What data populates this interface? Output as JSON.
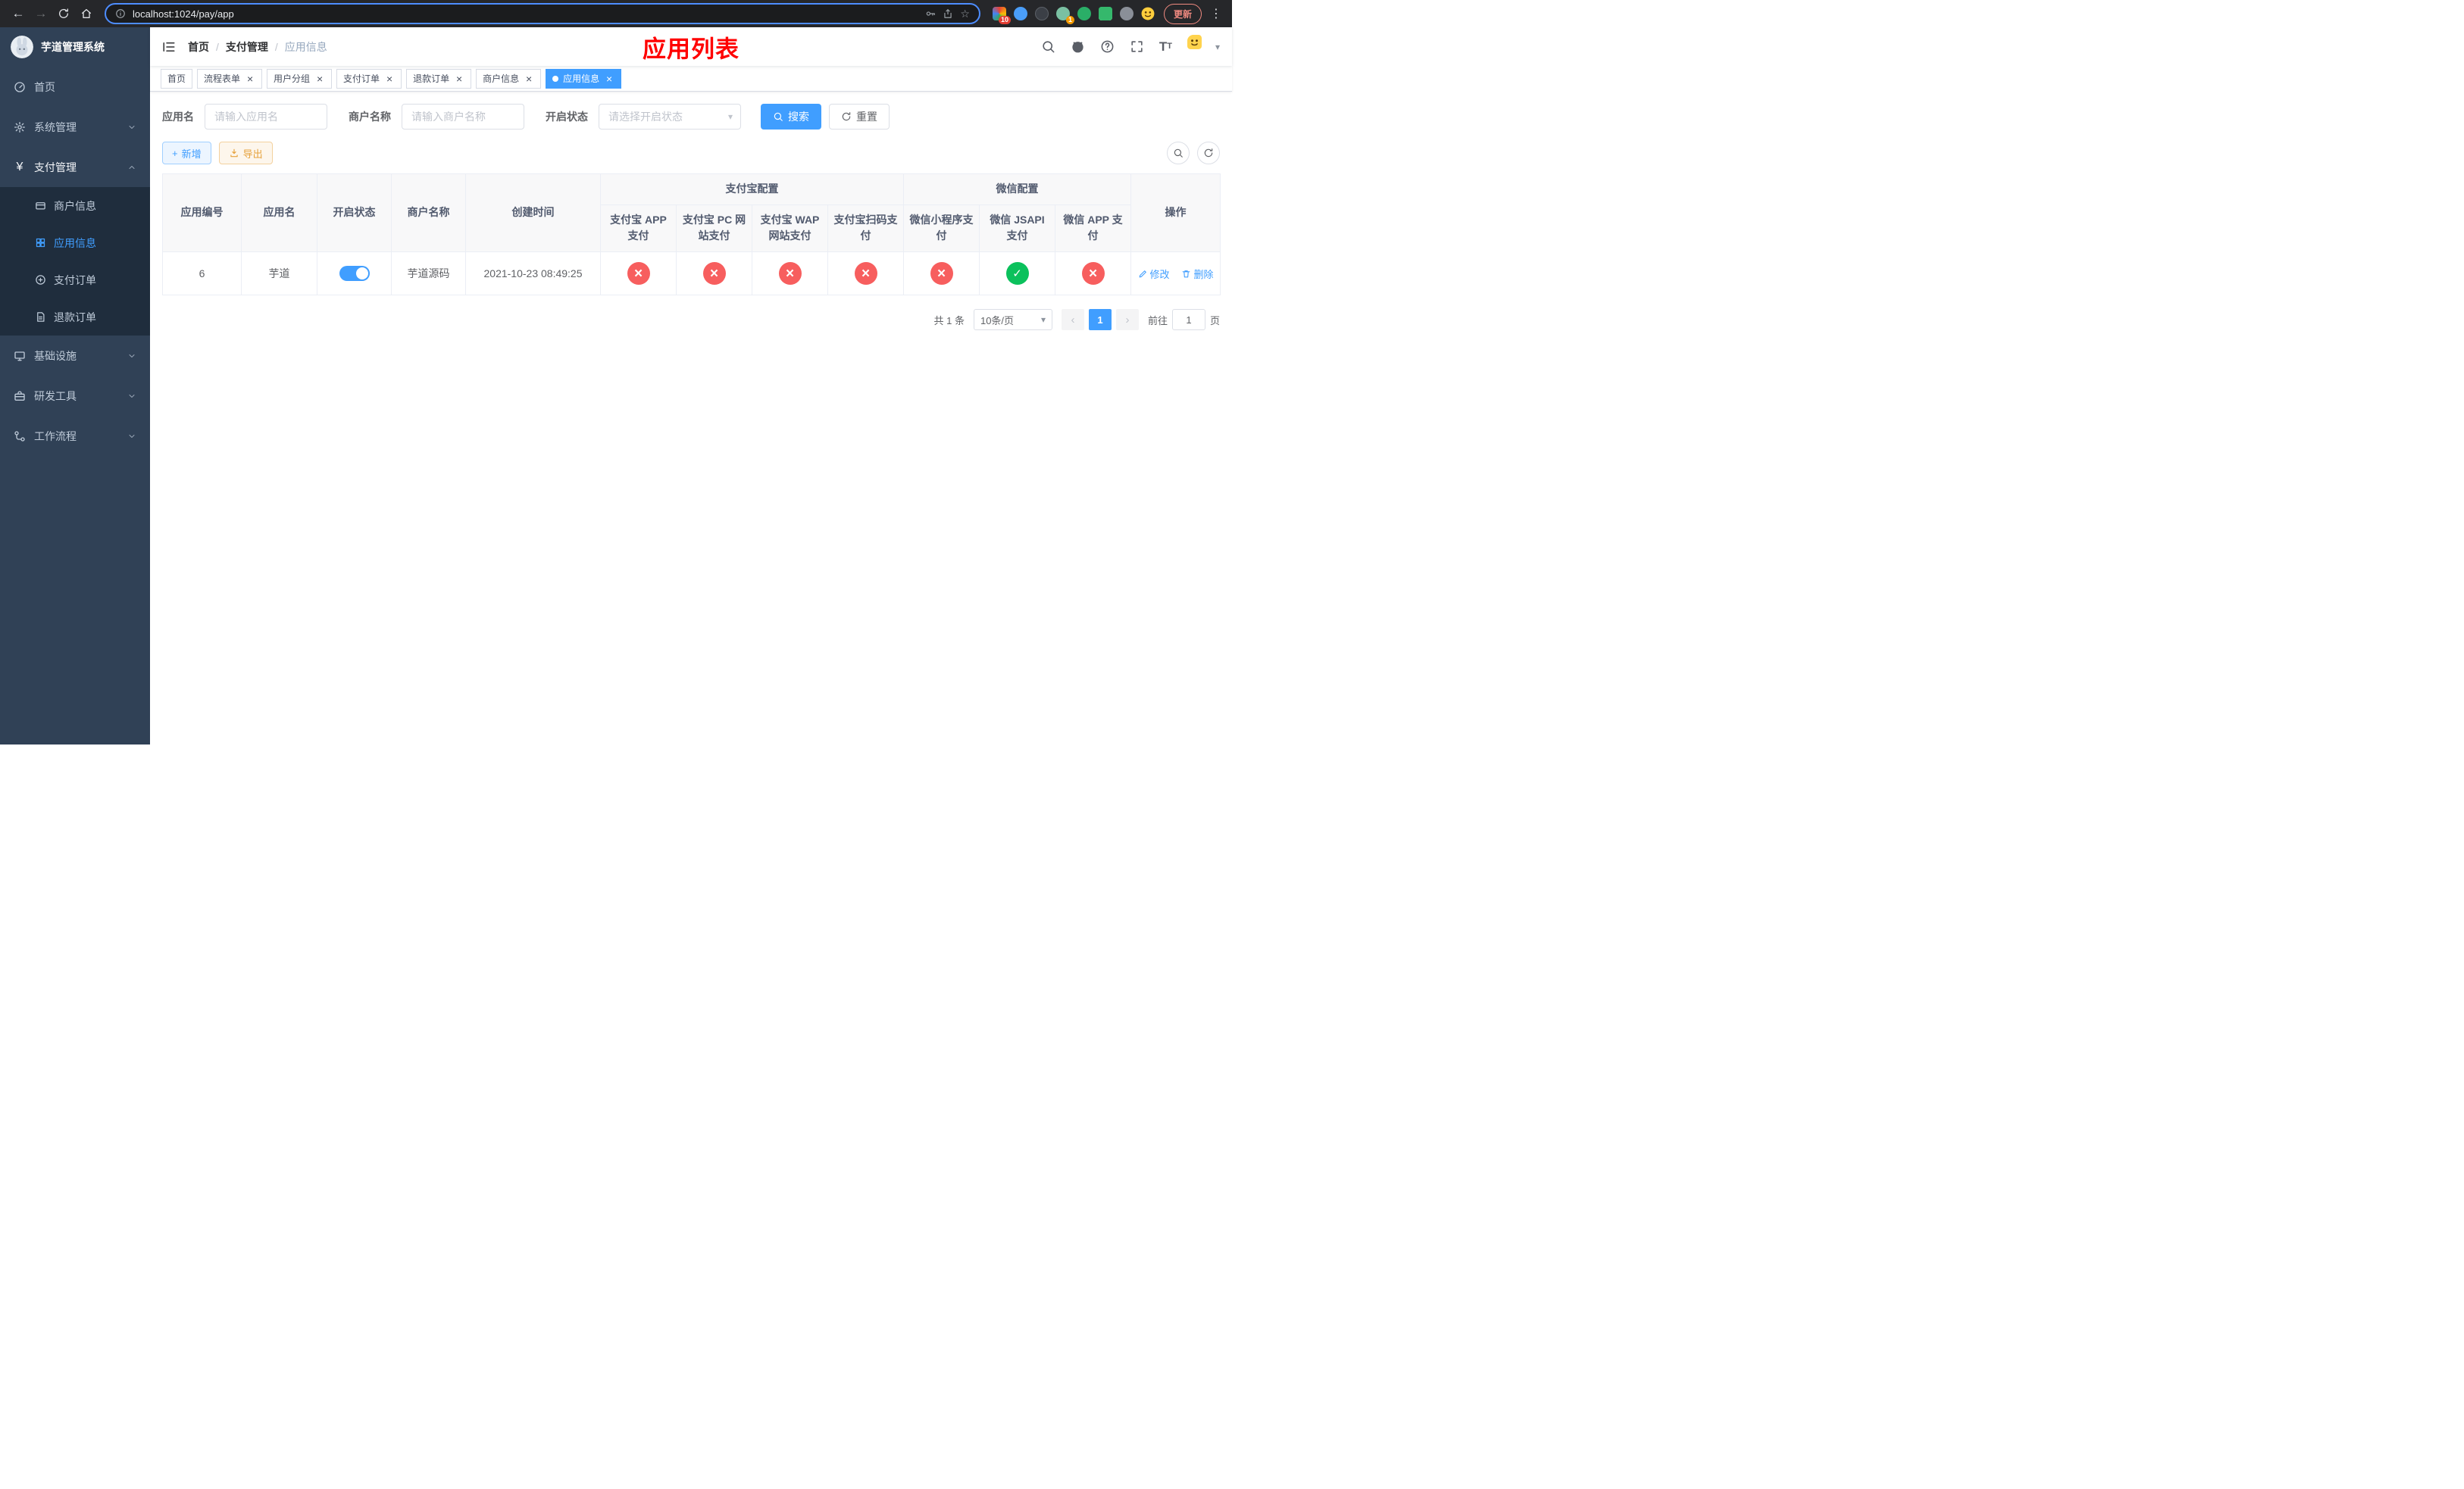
{
  "colors": {
    "accent": "#409eff",
    "status_pass": "#0bc15c",
    "status_fail": "#f75e5e",
    "annotation_red": "#ff0000",
    "warning": "#e6a23c",
    "sidebar_bg": "#304156",
    "submenu_bg": "#1f2d3d"
  },
  "icons": {
    "close": "×",
    "caret_down": "▾",
    "back": "←",
    "forward": "→",
    "star": "☆",
    "menu_dots": "⋮",
    "plus": "+",
    "yuan": "¥",
    "prev": "‹",
    "next": "›",
    "font_size": "T"
  },
  "browser": {
    "url": "localhost:1024/pay/app",
    "update_label": "更新",
    "ext_badge_count": "10",
    "ext_badge_count2": "1"
  },
  "sidebar": {
    "title": "芋道管理系统",
    "items": [
      {
        "label": "首页"
      },
      {
        "label": "系统管理"
      },
      {
        "label": "支付管理"
      },
      {
        "label": "基础设施"
      },
      {
        "label": "研发工具"
      },
      {
        "label": "工作流程"
      }
    ],
    "payment_children": [
      {
        "label": "商户信息"
      },
      {
        "label": "应用信息"
      },
      {
        "label": "支付订单"
      },
      {
        "label": "退款订单"
      }
    ]
  },
  "header": {
    "separator": "/",
    "breadcrumb": [
      {
        "label": "首页"
      },
      {
        "label": "支付管理"
      },
      {
        "label": "应用信息"
      }
    ],
    "annotation": "应用列表"
  },
  "tabs": [
    {
      "label": "首页"
    },
    {
      "label": "流程表单"
    },
    {
      "label": "用户分组"
    },
    {
      "label": "支付订单"
    },
    {
      "label": "退款订单"
    },
    {
      "label": "商户信息"
    },
    {
      "label": "应用信息"
    }
  ],
  "filters": {
    "app_name": {
      "label": "应用名",
      "placeholder": "请输入应用名",
      "value": ""
    },
    "merchant_name": {
      "label": "商户名称",
      "placeholder": "请输入商户名称",
      "value": ""
    },
    "status": {
      "label": "开启状态",
      "placeholder": "请选择开启状态"
    },
    "search_label": "搜索",
    "reset_label": "重置"
  },
  "toolbar": {
    "add_label": "新增",
    "export_label": "导出"
  },
  "table": {
    "headers": {
      "app_id": "应用编号",
      "app_name": "应用名",
      "status": "开启状态",
      "merchant_name": "商户名称",
      "create_time": "创建时间",
      "alipay_group": "支付宝配置",
      "wechat_group": "微信配置",
      "actions": "操作"
    },
    "alipay_cols": [
      "支付宝 APP 支付",
      "支付宝 PC 网站支付",
      "支付宝 WAP 网站支付",
      "支付宝扫码支付"
    ],
    "wechat_cols": [
      "微信小程序支付",
      "微信 JSAPI 支付",
      "微信 APP 支付"
    ],
    "row": {
      "id": "6",
      "name": "芋道",
      "status_on": "on",
      "merchant": "芋道源码",
      "created": "2021-10-23 08:49:25",
      "configs": [
        "fail",
        "fail",
        "fail",
        "fail",
        "fail",
        "pass",
        "fail"
      ],
      "edit_label": "修改",
      "delete_label": "删除"
    }
  },
  "pagination": {
    "total": "共 1 条",
    "page_size": "10条/页",
    "page": "1",
    "goto_label": "前往",
    "goto_value": "1",
    "page_unit": "页"
  }
}
